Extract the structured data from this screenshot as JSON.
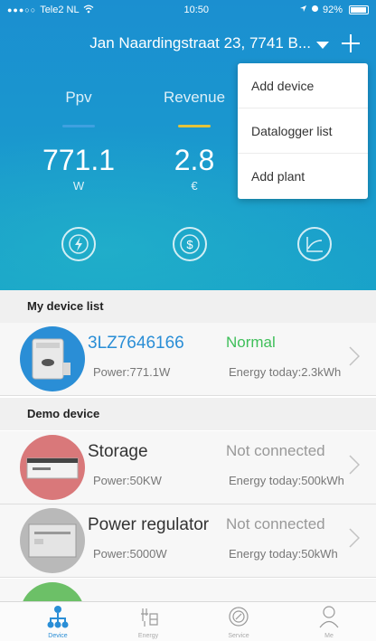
{
  "statusbar": {
    "carrier": "Tele2 NL",
    "time": "10:50",
    "battery": "92%"
  },
  "header": {
    "plant_name": "Jan Naardingstraat 23, 7741 B..."
  },
  "metrics": [
    {
      "label": "Ppv",
      "value": "771.1",
      "unit": "W",
      "bar_color": "#3fa0e0"
    },
    {
      "label": "Revenue",
      "value": "2.8",
      "unit": "€",
      "bar_color": "#e3c33a"
    }
  ],
  "dropdown": {
    "items": [
      "Add device",
      "Datalogger list",
      "Add plant"
    ]
  },
  "sections": {
    "my_devices": "My device list",
    "demo": "Demo device"
  },
  "devices": [
    {
      "name": "3LZ7646166",
      "power": "Power:771.1W",
      "status": "Normal",
      "energy": "Energy today:2.3kWh",
      "name_color": "#2a8ed6",
      "status_color": "#3fbf5a"
    },
    {
      "name": "Storage",
      "power": "Power:50KW",
      "status": "Not connected",
      "energy": "Energy today:500kWh"
    },
    {
      "name": "Power regulator",
      "power": "Power:5000W",
      "status": "Not connected",
      "energy": "Energy today:50kWh"
    }
  ],
  "tabs": [
    "Device",
    "Energy",
    "Service",
    "Me"
  ],
  "colors": {
    "accent": "#1b8fd0",
    "active_tab": "#2a8ed6"
  }
}
